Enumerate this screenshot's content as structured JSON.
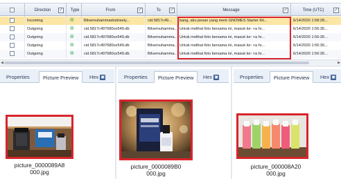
{
  "grid": {
    "headers": {
      "direction": "Direction",
      "type": "Type",
      "from": "From",
      "to": "To",
      "message": "Message",
      "time": "Time (UTC)"
    },
    "filter_glyph": "✓",
    "type_glyph": "⦾",
    "rows": [
      {
        "direction": "Incoming",
        "from": "Bilvemuhammadrizkisety...",
        "to": "cid.5817c49...",
        "message": "bang, aku pesan yang merk GNOMES Starter Kit...",
        "time": "6/14/2020 1:58:28..."
      },
      {
        "direction": "Outgoing",
        "from": "cid.5817c497680ce549.db",
        "to": "Bilvemuhamma...",
        "message": "Untuk melihat foto bersama ini, masuk ke: <a hr...",
        "time": "6/14/2020 1:56:30..."
      },
      {
        "direction": "Outgoing",
        "from": "cid.5817c497680ce549.db",
        "to": "Bilvemuhamma...",
        "message": "Untuk melihat foto bersama ini, masuk ke: <a hr...",
        "time": "6/14/2020 1:56:30..."
      },
      {
        "direction": "Outgoing",
        "from": "cid.5817c497680ce549.db",
        "to": "Bilvemuhamma...",
        "message": "Untuk melihat foto bersama ini, masuk ke: <a hr...",
        "time": "6/14/2020 1:56:30..."
      },
      {
        "direction": "Outgoing",
        "from": "cid.5817c497680ce549.db",
        "to": "Bilvemuhamma...",
        "message": "Untuk melihat foto bersama ini, masuk ke: <a hr...",
        "time": "6/14/2020 1:56:30..."
      }
    ]
  },
  "panels": [
    {
      "tab_properties": "Properties",
      "tab_preview": "Picture Preview",
      "tab_hex": "Hex",
      "filename_line1": "picture_0000089A8",
      "filename_line2": "000.jpg"
    },
    {
      "tab_properties": "Properties",
      "tab_preview": "Picture Preview",
      "tab_hex": "Hex",
      "filename_line1": "picture_0000089B0",
      "filename_line2": "000.jpg"
    },
    {
      "tab_properties": "Properties",
      "tab_preview": "Picture Preview",
      "tab_hex": "Hex",
      "filename_line1": "picture_000008A20",
      "filename_line2": "000.jpg"
    }
  ],
  "hex_icon_glyph": "▣",
  "colors": {
    "highlight": "#d9242b",
    "selected_row": "#fbe6a6",
    "header_bg": "#dfe6f1",
    "tab_bar": "#eaf0f8"
  }
}
